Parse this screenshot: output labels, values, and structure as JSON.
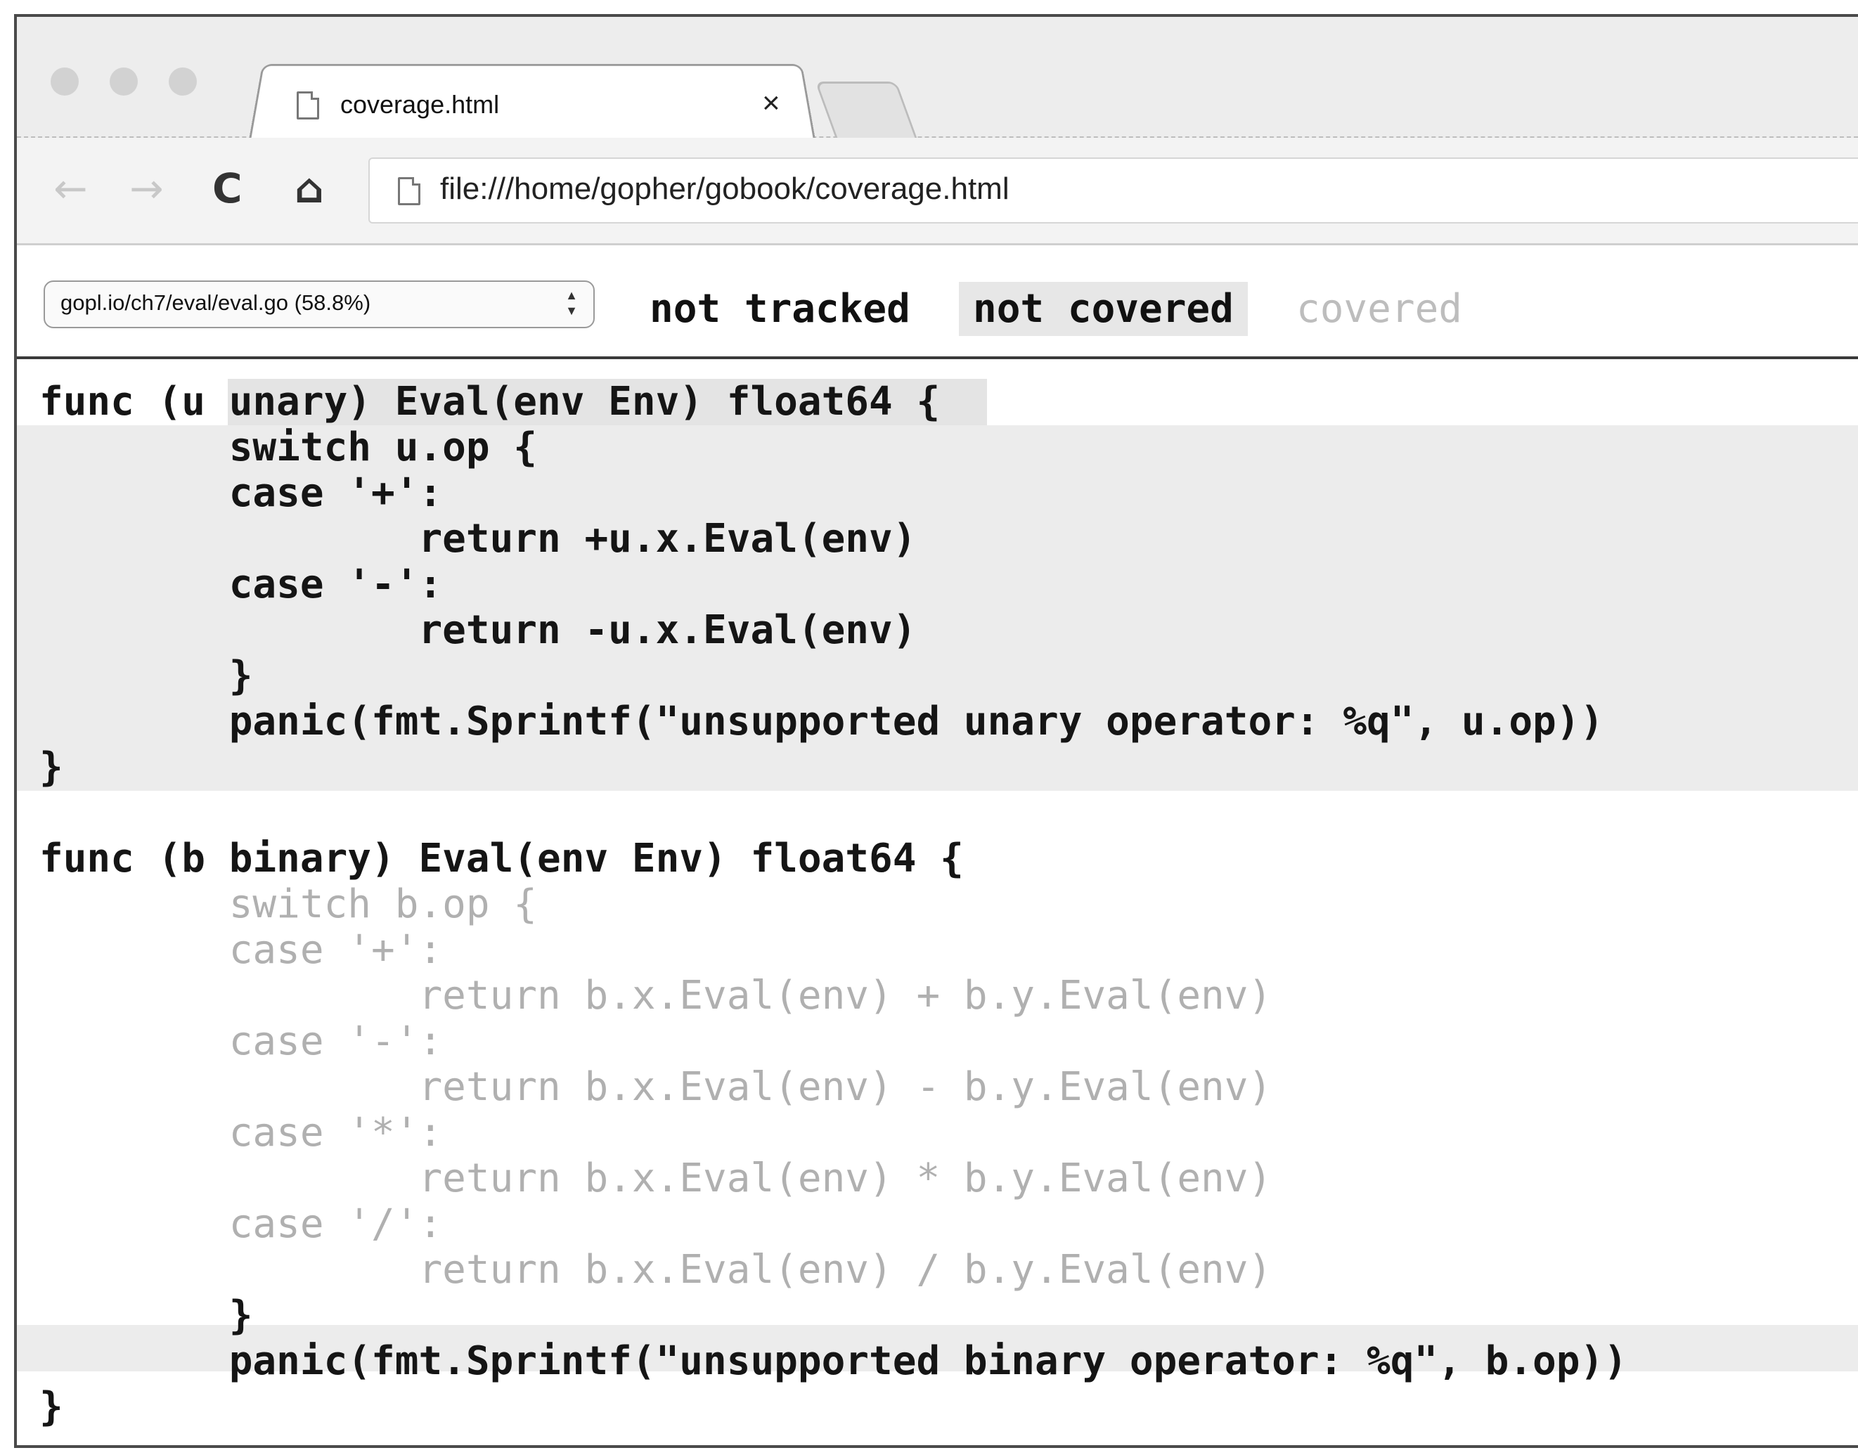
{
  "browser": {
    "tab": {
      "title": "coverage.html",
      "close": "×"
    },
    "toolbar": {
      "back": "←",
      "forward": "→",
      "reload": "C",
      "home": "⌂",
      "url": "file:///home/gopher/gobook/coverage.html"
    }
  },
  "coverage": {
    "file_select": {
      "value": "gopl.io/ch7/eval/eval.go (58.8%)",
      "arrow_up": "▲",
      "arrow_down": "▼"
    },
    "legend": {
      "not_tracked": "not tracked",
      "not_covered": "not covered",
      "covered": "covered"
    }
  },
  "code": {
    "lines": [
      {
        "text": "func (u unary) Eval(env Env) float64 {",
        "status": "not_covered"
      },
      {
        "text": "        switch u.op {",
        "status": "not_covered"
      },
      {
        "text": "        case '+':",
        "status": "not_covered"
      },
      {
        "text": "                return +u.x.Eval(env)",
        "status": "not_covered"
      },
      {
        "text": "        case '-':",
        "status": "not_covered"
      },
      {
        "text": "                return -u.x.Eval(env)",
        "status": "not_covered"
      },
      {
        "text": "        }",
        "status": "not_covered"
      },
      {
        "text": "        panic(fmt.Sprintf(\"unsupported unary operator: %q\", u.op))",
        "status": "not_covered"
      },
      {
        "text": "}",
        "status": "not_tracked"
      },
      {
        "text": "",
        "status": "not_tracked"
      },
      {
        "text": "func (b binary) Eval(env Env) float64 {",
        "status": "not_tracked"
      },
      {
        "text": "        switch b.op {",
        "status": "covered"
      },
      {
        "text": "        case '+':",
        "status": "covered"
      },
      {
        "text": "                return b.x.Eval(env) + b.y.Eval(env)",
        "status": "covered"
      },
      {
        "text": "        case '-':",
        "status": "covered"
      },
      {
        "text": "                return b.x.Eval(env) - b.y.Eval(env)",
        "status": "covered"
      },
      {
        "text": "        case '*':",
        "status": "covered"
      },
      {
        "text": "                return b.x.Eval(env) * b.y.Eval(env)",
        "status": "covered"
      },
      {
        "text": "        case '/':",
        "status": "covered"
      },
      {
        "text": "                return b.x.Eval(env) / b.y.Eval(env)",
        "status": "covered"
      },
      {
        "text": "        }",
        "status": "not_tracked"
      },
      {
        "text": "        panic(fmt.Sprintf(\"unsupported binary operator: %q\", b.op))",
        "status": "not_covered"
      },
      {
        "text": "}",
        "status": "not_tracked"
      }
    ]
  }
}
